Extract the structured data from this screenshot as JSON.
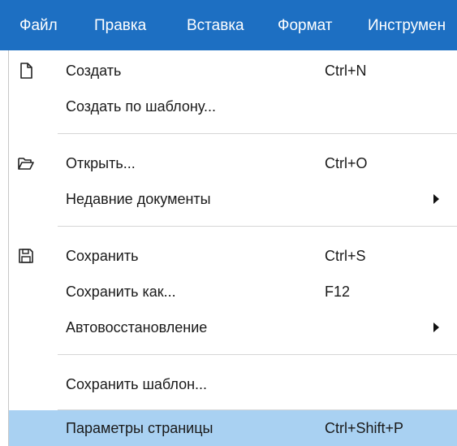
{
  "menubar": {
    "items": [
      {
        "label": "Файл"
      },
      {
        "label": "Правка"
      },
      {
        "label": "Вставка"
      },
      {
        "label": "Формат"
      },
      {
        "label": "Инструмен"
      }
    ]
  },
  "menu": {
    "items": [
      {
        "label": "Создать",
        "shortcut": "Ctrl+N",
        "icon": "new-document-icon"
      },
      {
        "label": "Создать по шаблону...",
        "shortcut": ""
      },
      {
        "label": "Открыть...",
        "shortcut": "Ctrl+O",
        "icon": "open-folder-icon"
      },
      {
        "label": "Недавние документы",
        "shortcut": "",
        "submenu": true
      },
      {
        "label": "Сохранить",
        "shortcut": "Ctrl+S",
        "icon": "save-floppy-icon"
      },
      {
        "label": "Сохранить как...",
        "shortcut": "F12"
      },
      {
        "label": "Автовосстановление",
        "shortcut": "",
        "submenu": true
      },
      {
        "label": "Сохранить шаблон...",
        "shortcut": ""
      },
      {
        "label": "Параметры страницы",
        "shortcut": "Ctrl+Shift+P",
        "highlighted": true
      }
    ]
  },
  "colors": {
    "menubar_bg": "#1d6fc2",
    "highlight_bg": "#a9d1f2",
    "separator": "#d6d6d6"
  }
}
